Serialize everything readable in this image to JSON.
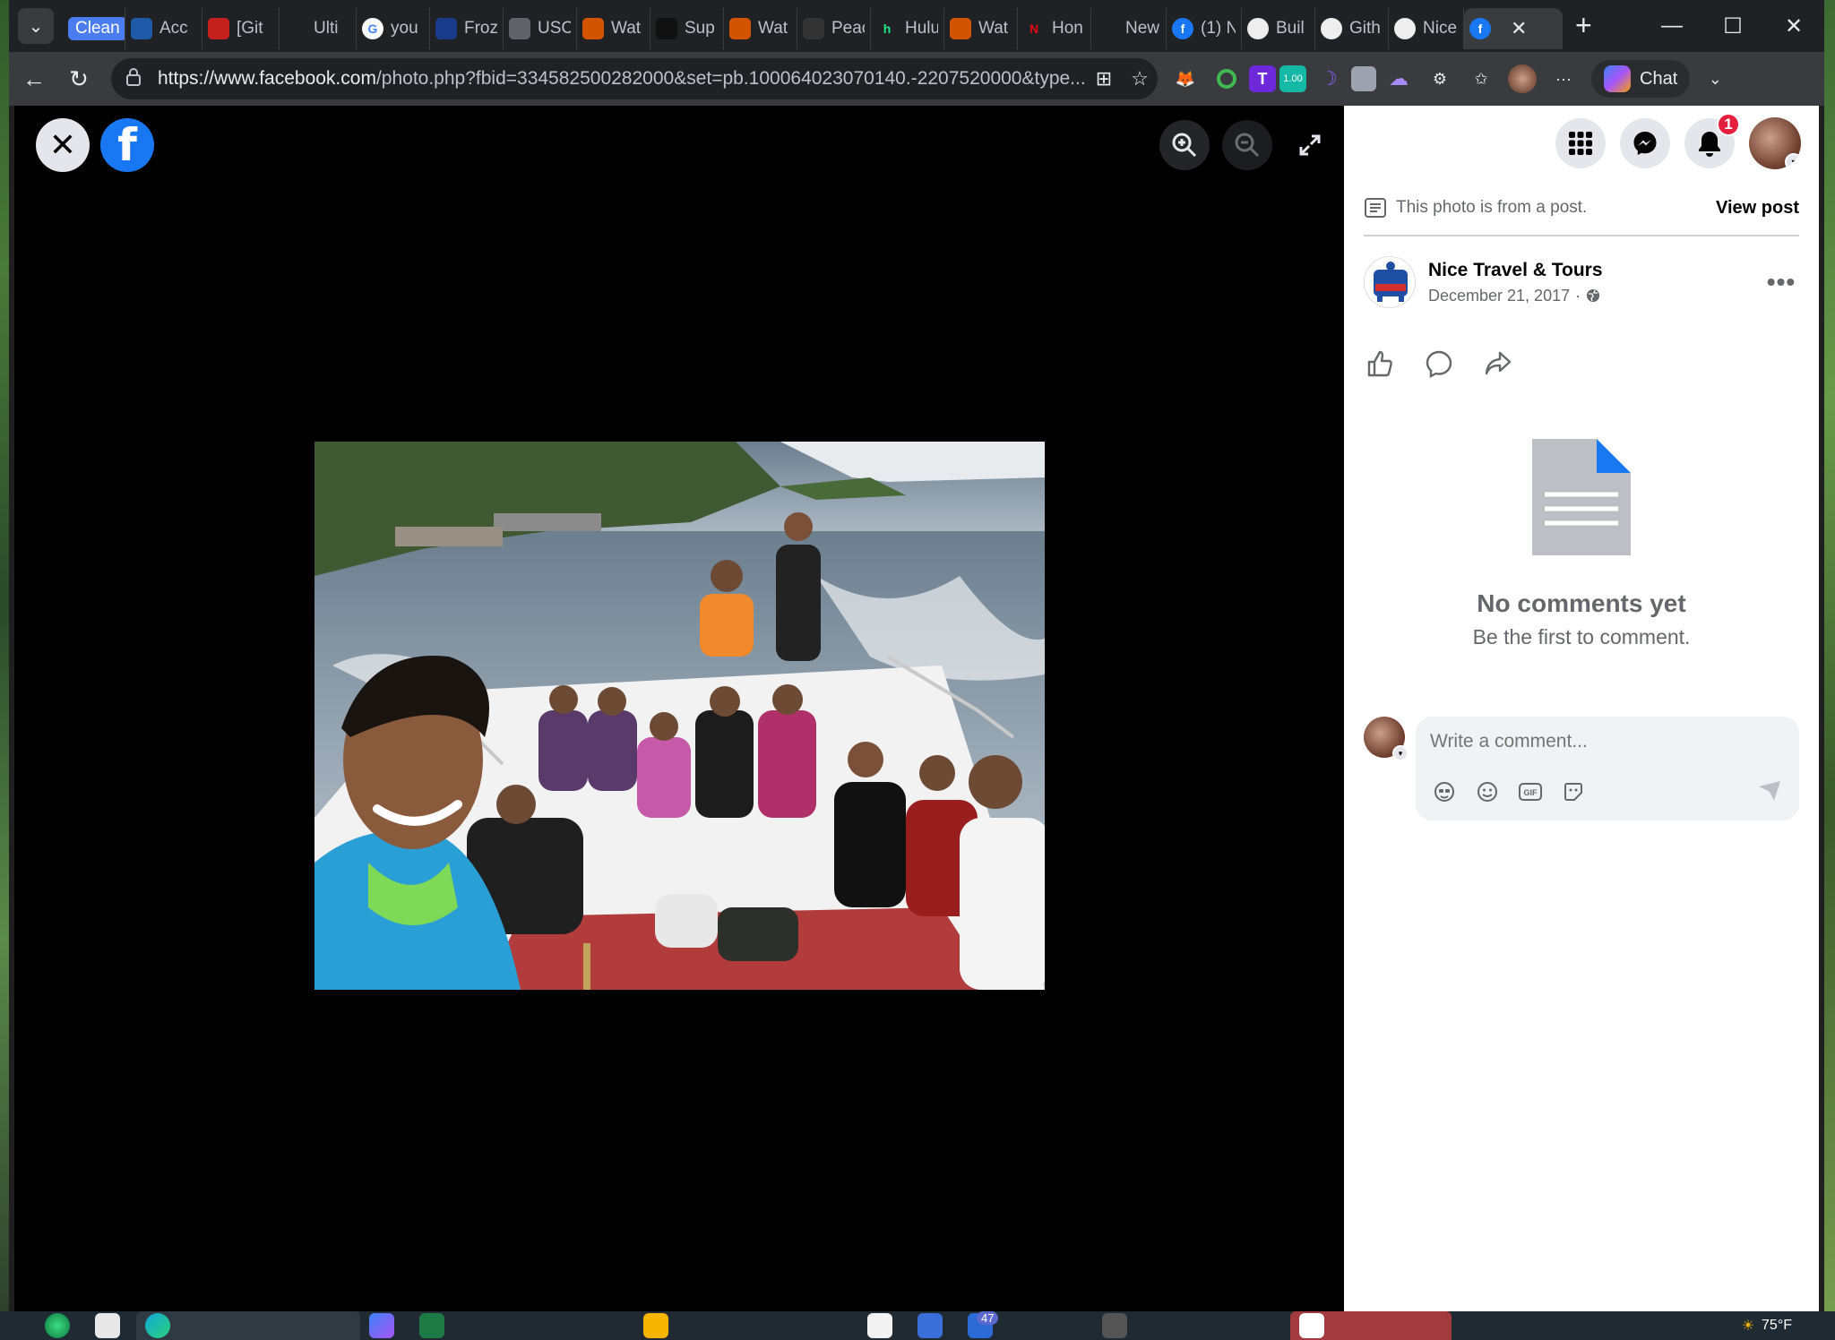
{
  "browser": {
    "tabs": [
      {
        "title": "Clean",
        "type": "pill"
      },
      {
        "title": "Acc",
        "favicon": "site-blue",
        "color": "#1e5aa8"
      },
      {
        "title": "[Git",
        "favicon": "gmail",
        "color": "#c5221f"
      },
      {
        "title": "Ulti",
        "favicon": "blank",
        "color": "#202124"
      },
      {
        "title": "you",
        "favicon": "google",
        "color": "#4285f4"
      },
      {
        "title": "Froz",
        "favicon": "library",
        "color": "#1a3a8a"
      },
      {
        "title": "USC",
        "favicon": "circle",
        "color": "#5f6368"
      },
      {
        "title": "Wat",
        "favicon": "orange-app",
        "color": "#d35400"
      },
      {
        "title": "Sup",
        "favicon": "appletv",
        "color": "#111"
      },
      {
        "title": "Wat",
        "favicon": "orange-app",
        "color": "#d35400"
      },
      {
        "title": "Peac",
        "favicon": "peacock",
        "color": "#333"
      },
      {
        "title": "Hulu",
        "favicon": "hulu",
        "color": "#1ce783"
      },
      {
        "title": "Wat",
        "favicon": "orange-app",
        "color": "#d35400"
      },
      {
        "title": "Hon",
        "favicon": "netflix",
        "color": "#e50914"
      },
      {
        "title": "New",
        "favicon": "triangle",
        "color": "#202124"
      },
      {
        "title": "(1) N",
        "favicon": "facebook",
        "color": "#1877f2"
      },
      {
        "title": "Buil",
        "favicon": "openai",
        "color": "#eee"
      },
      {
        "title": "Gith",
        "favicon": "github",
        "color": "#eee"
      },
      {
        "title": "Nice",
        "favicon": "globe",
        "color": "#eee"
      },
      {
        "title": "",
        "favicon": "facebook",
        "color": "#1877f2",
        "active": true
      }
    ],
    "new_tab_label": "+",
    "window_controls": {
      "minimize": "—",
      "maximize": "☐",
      "close": "✕"
    },
    "url_host": "https://www.facebook.com",
    "url_rest": "/photo.php?fbid=334582500282000&set=pb.100064023070140.-2207520000&type...",
    "chat_label": "Chat"
  },
  "photo_viewer": {
    "close_icon": "✕",
    "logo_letter": "f"
  },
  "side_panel": {
    "notification_count": "1",
    "from_post_text": "This photo is from a post.",
    "view_post_label": "View post",
    "page_name": "Nice Travel & Tours",
    "post_date": "December 21, 2017",
    "post_date_sep": "·",
    "more_label": "•••",
    "empty_title": "No comments yet",
    "empty_subtitle": "Be the first to comment.",
    "comment_placeholder": "Write a comment..."
  },
  "taskbar": {
    "weather_temp": "75°F",
    "task_count": "47"
  }
}
